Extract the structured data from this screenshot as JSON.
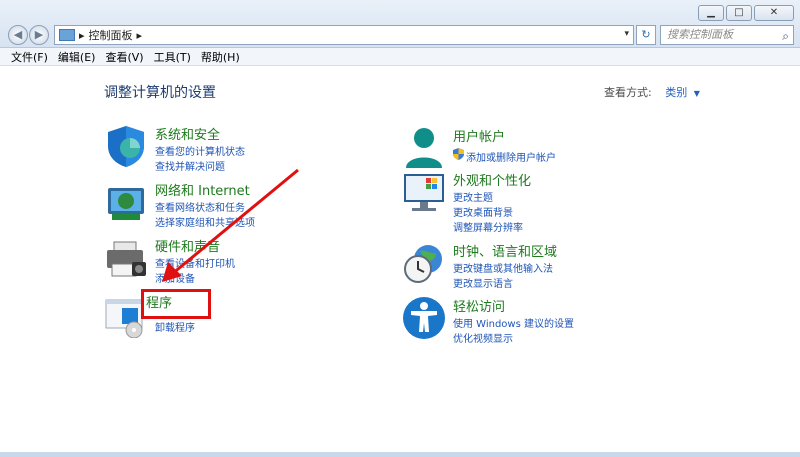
{
  "window": {
    "minimize": "▁",
    "maximize": "□",
    "close": "✕"
  },
  "address": {
    "path_sep": "▸",
    "path": "控制面板",
    "path_sep2": "▸",
    "dropdown": "▾",
    "refresh": "↻",
    "search_placeholder": "搜索控制面板",
    "back": "◀",
    "forward": "▶"
  },
  "menu": [
    "文件(F)",
    "编辑(E)",
    "查看(V)",
    "工具(T)",
    "帮助(H)"
  ],
  "heading": "调整计算机的设置",
  "view_by": {
    "label": "查看方式:",
    "value": "类别"
  },
  "categories_left": [
    {
      "title": "系统和安全",
      "links": [
        "查看您的计算机状态",
        "查找并解决问题"
      ]
    },
    {
      "title": "网络和 Internet",
      "links": [
        "查看网络状态和任务",
        "选择家庭组和共享选项"
      ]
    },
    {
      "title": "硬件和声音",
      "links": [
        "查看设备和打印机",
        "添加设备"
      ]
    },
    {
      "title": "程序",
      "links": [
        "卸载程序"
      ]
    }
  ],
  "categories_right": [
    {
      "title": "用户帐户",
      "links": [
        "添加或删除用户帐户"
      ]
    },
    {
      "title": "外观和个性化",
      "links": [
        "更改主题",
        "更改桌面背景",
        "调整屏幕分辨率"
      ]
    },
    {
      "title": "时钟、语言和区域",
      "links": [
        "更改键盘或其他输入法",
        "更改显示语言"
      ]
    },
    {
      "title": "轻松访问",
      "links": [
        "使用 Windows 建议的设置",
        "优化视频显示"
      ]
    }
  ],
  "colors": {
    "category_title": "#1d7a1d",
    "link": "#1f55b5",
    "highlight": "#e01010"
  },
  "icons": [
    "shield-icon",
    "network-icon",
    "printer-icon",
    "programs-icon",
    "user-icon",
    "display-icon",
    "clock-globe-icon",
    "accessibility-icon",
    "uac-shield-icon",
    "search-icon",
    "refresh-icon",
    "control-panel-icon"
  ]
}
